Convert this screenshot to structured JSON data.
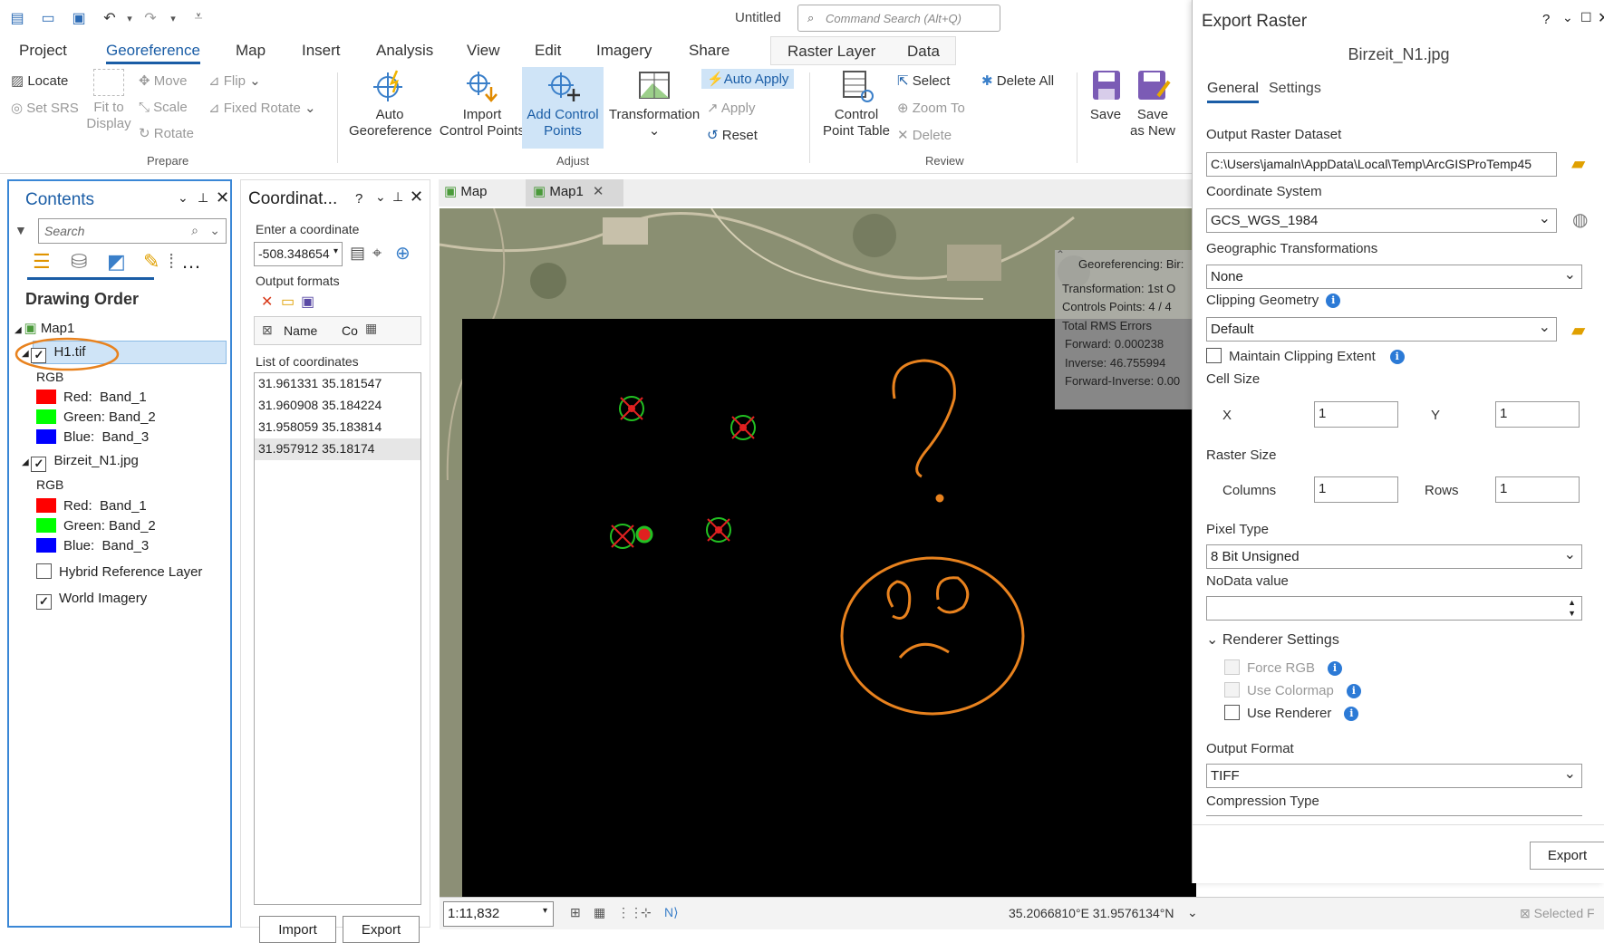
{
  "titlebar": {
    "title": "Untitled",
    "search_placeholder": "Command Search (Alt+Q)"
  },
  "tabs": [
    "Project",
    "Georeference",
    "Map",
    "Insert",
    "Analysis",
    "View",
    "Edit",
    "Imagery",
    "Share"
  ],
  "context_tabs": [
    "Raster Layer",
    "Data"
  ],
  "ribbon": {
    "prepare": {
      "locate": "Locate",
      "set_srs": "Set SRS",
      "fit_to_display": "Fit to\nDisplay",
      "move": "Move",
      "scale": "Scale",
      "rotate": "Rotate",
      "flip": "Flip",
      "fixed_rotate": "Fixed Rotate",
      "group": "Prepare"
    },
    "adjust": {
      "auto_georef": "Auto\nGeoreference",
      "import_cp": "Import\nControl Points",
      "add_cp": "Add Control\nPoints",
      "transformation": "Transformation",
      "auto_apply": "Auto Apply",
      "apply": "Apply",
      "reset": "Reset",
      "group": "Adjust"
    },
    "review": {
      "cp_table": "Control\nPoint Table",
      "select": "Select",
      "zoom_to": "Zoom To",
      "delete": "Delete",
      "delete_all": "Delete All",
      "group": "Review"
    },
    "save": "Save",
    "save_as_new": "Save\nas New"
  },
  "contents": {
    "title": "Contents",
    "search_placeholder": "Search",
    "drawing_order": "Drawing Order",
    "map": "Map1",
    "layers": [
      {
        "name": "H1.tif",
        "checked": true,
        "selected": true,
        "renderer": "RGB",
        "bands": [
          {
            "label": "Red:",
            "band": "Band_1",
            "color": "#ff0000"
          },
          {
            "label": "Green:",
            "band": "Band_2",
            "color": "#00ff00"
          },
          {
            "label": "Blue:",
            "band": "Band_3",
            "color": "#0000ff"
          }
        ]
      },
      {
        "name": "Birzeit_N1.jpg",
        "checked": true,
        "renderer": "RGB",
        "bands": [
          {
            "label": "Red:",
            "band": "Band_1",
            "color": "#ff0000"
          },
          {
            "label": "Green:",
            "band": "Band_2",
            "color": "#00ff00"
          },
          {
            "label": "Blue:",
            "band": "Band_3",
            "color": "#0000ff"
          }
        ]
      },
      {
        "name": "Hybrid Reference Layer",
        "checked": false
      },
      {
        "name": "World Imagery",
        "checked": true
      }
    ]
  },
  "coordinates": {
    "title": "Coordinat...",
    "enter_label": "Enter a coordinate",
    "coord_value": "-508.348654",
    "output_formats": "Output formats",
    "col_name": "Name",
    "col_co": "Co",
    "list_label": "List of coordinates",
    "list": [
      "31.961331 35.181547",
      "31.960908 35.184224",
      "31.958059 35.183814",
      "31.957912 35.18174"
    ],
    "import": "Import",
    "export": "Export"
  },
  "map": {
    "tabs": [
      "Map",
      "Map1"
    ],
    "overlay": {
      "title": "Georeferencing: Bir:",
      "transformation": "Transformation: 1st O",
      "controls": "Controls Points: 4 / 4",
      "rms": "Total RMS Errors",
      "forward": "Forward: 0.000238",
      "inverse": "Inverse: 46.755994",
      "fi": "Forward-Inverse: 0.00"
    },
    "scale": "1:11,832",
    "coords": "35.2066810°E 31.9576134°N",
    "selected": "Selected F"
  },
  "export_raster": {
    "title": "Export Raster",
    "help": "?",
    "subtitle": "Birzeit_N1.jpg",
    "tab_general": "General",
    "tab_settings": "Settings",
    "output_dataset_label": "Output Raster Dataset",
    "output_dataset": "C:\\Users\\jamaln\\AppData\\Local\\Temp\\ArcGISProTemp45",
    "coord_sys_label": "Coordinate System",
    "coord_sys": "GCS_WGS_1984",
    "geo_trans_label": "Geographic Transformations",
    "geo_trans": "None",
    "clip_label": "Clipping Geometry",
    "clip": "Default",
    "maintain_clip": "Maintain Clipping Extent",
    "cell_size_label": "Cell Size",
    "x_label": "X",
    "x_value": "1",
    "y_label": "Y",
    "y_value": "1",
    "raster_size_label": "Raster Size",
    "columns_label": "Columns",
    "columns": "1",
    "rows_label": "Rows",
    "rows": "1",
    "pixel_type_label": "Pixel Type",
    "pixel_type": "8 Bit Unsigned",
    "nodata_label": "NoData value",
    "nodata": "",
    "renderer_label": "Renderer Settings",
    "force_rgb": "Force RGB",
    "use_colormap": "Use Colormap",
    "use_renderer": "Use Renderer",
    "output_format_label": "Output Format",
    "output_format": "TIFF",
    "compression_label": "Compression Type",
    "export_button": "Export"
  }
}
